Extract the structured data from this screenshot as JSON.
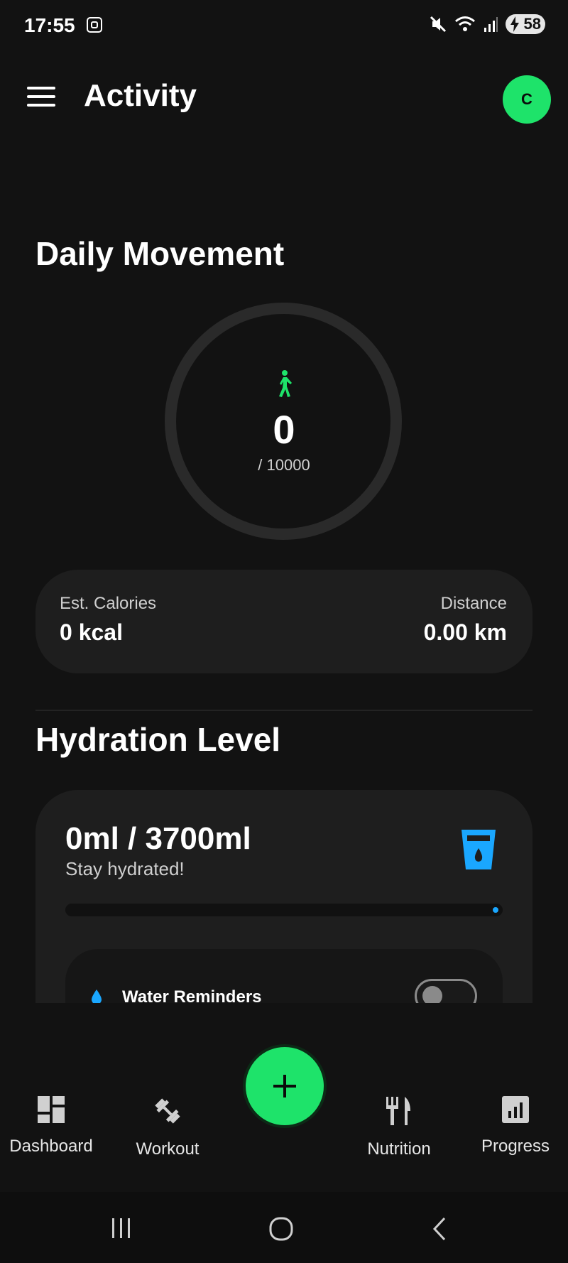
{
  "status_bar": {
    "time": "17:55",
    "battery": "58"
  },
  "app_bar": {
    "title": "Activity",
    "avatar_initial": "C"
  },
  "daily_movement": {
    "title": "Daily Movement",
    "steps": "0",
    "goal": "/ 10000",
    "calories_label": "Est. Calories",
    "calories_value": "0 kcal",
    "distance_label": "Distance",
    "distance_value": "0.00 km"
  },
  "hydration": {
    "title": "Hydration Level",
    "amount": "0ml / 3700ml",
    "subtitle": "Stay hydrated!",
    "progress": 0,
    "reminder_label": "Water Reminders",
    "reminder_enabled": false
  },
  "bottom_nav": {
    "items": [
      {
        "label": "Dashboard",
        "icon": "dashboard-icon"
      },
      {
        "label": "Workout",
        "icon": "dumbbell-icon"
      },
      {
        "label": "Nutrition",
        "icon": "fork-knife-icon"
      },
      {
        "label": "Progress",
        "icon": "bar-chart-icon"
      }
    ],
    "fab_icon": "plus-icon"
  },
  "colors": {
    "accent": "#1ee36a",
    "water": "#1aa7ff",
    "background": "#121212",
    "card": "#1e1e1e"
  }
}
